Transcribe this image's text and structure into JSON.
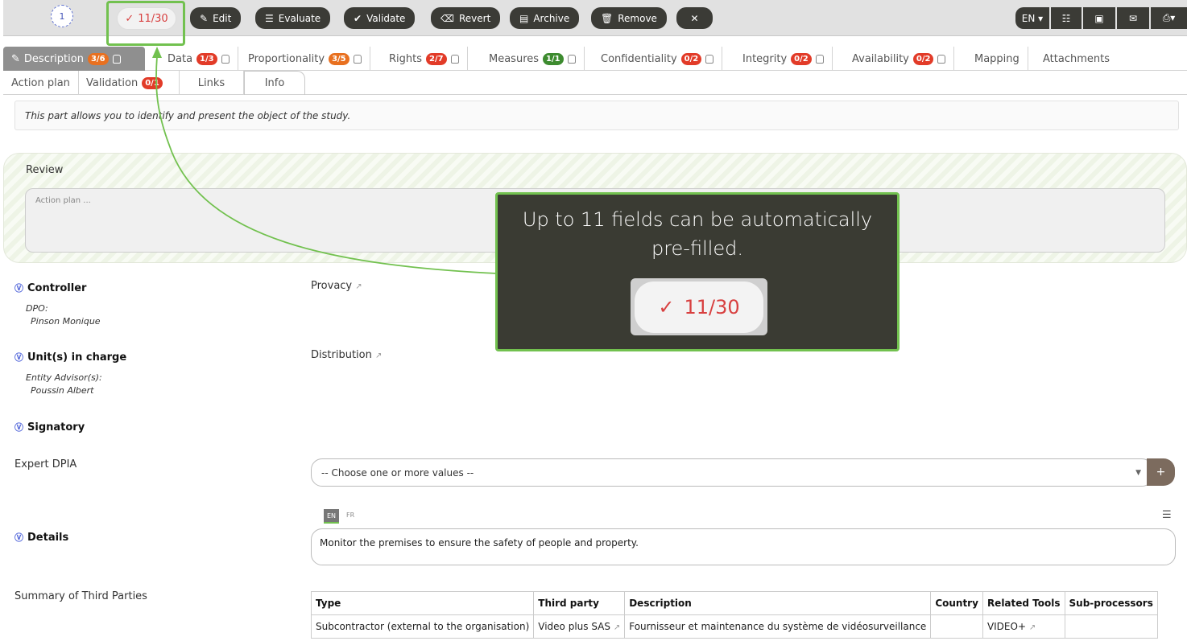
{
  "toolbar": {
    "step": "1",
    "counter": "11/30",
    "edit": "Edit",
    "evaluate": "Evaluate",
    "validate": "Validate",
    "revert": "Revert",
    "archive": "Archive",
    "remove": "Remove",
    "close": "✕",
    "lang": "EN ▾"
  },
  "tabs_row1": [
    {
      "label": "Description",
      "badge": "3/6"
    },
    {
      "label": "Data",
      "badge": "1/3"
    },
    {
      "label": "Proportionality",
      "badge": "3/5"
    },
    {
      "label": "Rights",
      "badge": "2/7"
    },
    {
      "label": "Measures",
      "badge": "1/1"
    },
    {
      "label": "Confidentiality",
      "badge": "0/2"
    },
    {
      "label": "Integrity",
      "badge": "0/2"
    },
    {
      "label": "Availability",
      "badge": "0/2"
    },
    {
      "label": "Mapping"
    },
    {
      "label": "Attachments"
    }
  ],
  "tabs_row2": [
    {
      "label": "Action plan"
    },
    {
      "label": "Validation",
      "badge": "0/1"
    },
    {
      "label": "Links"
    },
    {
      "label": "Info"
    }
  ],
  "intro": "This part allows you to identify and present the object of the study.",
  "review": {
    "label": "Review",
    "placeholder": "Action plan ..."
  },
  "controller": {
    "title": "Controller",
    "role": "DPO:",
    "person": "Pinson Monique",
    "value": "Provacy"
  },
  "unit": {
    "title": "Unit(s) in charge",
    "role": "Entity Advisor(s):",
    "person": "Poussin Albert",
    "value": "Distribution"
  },
  "signatory": {
    "title": "Signatory"
  },
  "expert": {
    "label": "Expert DPIA",
    "placeholder": "-- Choose one or more values --"
  },
  "details": {
    "title": "Details",
    "lang_en": "EN",
    "lang_fr": "FR",
    "text": "Monitor the premises to ensure the safety of people and property."
  },
  "third_parties": {
    "label": "Summary of Third Parties",
    "headers": [
      "Type",
      "Third party",
      "Description",
      "Country",
      "Related Tools",
      "Sub-processors"
    ],
    "row": [
      "Subcontractor (external to the organisation)",
      "Video plus SAS",
      "Fournisseur et maintenance du système de vidéosurveillance",
      "",
      "VIDEO+",
      ""
    ]
  },
  "tooltip": {
    "message": "Up to 11 fields can be automatically pre-filled.",
    "counter": "11/30"
  },
  "colors": {
    "highlight": "#72c14f",
    "dark": "#3a3b33",
    "counter": "#d84040"
  }
}
